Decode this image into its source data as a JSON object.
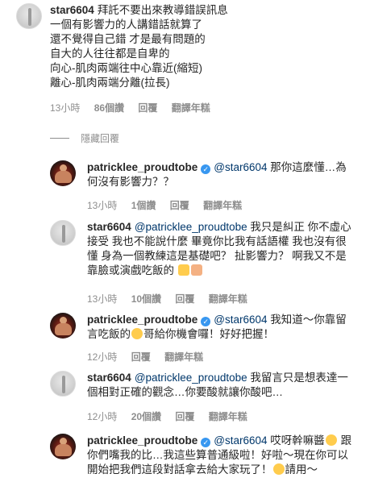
{
  "comments": [
    {
      "username": "star6604",
      "text": "拜託不要出來教導錯誤訊息\n一個有影響力的人講錯話就算了\n還不覺得自己錯 才是最有問題的\n自大的人往往都是自卑的\n向心-肌肉兩端往中心靠近(縮短)\n離心-肌肉兩端分離(拉長)",
      "time": "13小時",
      "likes": "86個讚",
      "reply": "回覆",
      "translate": "翻譯年糕"
    }
  ],
  "hide_replies_label": "隱藏回覆",
  "replies": [
    {
      "username": "patricklee_proudtobe",
      "mention": "@star6604",
      "text": "那你這麼懂…為何沒有影響力？？",
      "time": "13小時",
      "likes": "1個讚",
      "reply": "回覆",
      "translate": "翻譯年糕"
    },
    {
      "username": "star6604",
      "mention": "@patricklee_proudtobe",
      "text": "我只是糾正 你不虛心接受 我也不能說什麼 畢竟你比我有話語權 我也沒有很懂 身為一個教練這是基礎吧？ 扯影響力？ 啊我又不是靠臉或演戲吃飯的",
      "time": "13小時",
      "likes": "10個讚",
      "reply": "回覆",
      "translate": "翻譯年糕"
    },
    {
      "username": "patricklee_proudtobe",
      "mention": "@star6604",
      "text_a": "我知道～你靠留言吃飯的",
      "text_b": "哥給你機會囉！好好把握！",
      "time": "12小時",
      "likes": "",
      "reply": "回覆",
      "translate": "翻譯年糕"
    },
    {
      "username": "star6604",
      "mention": "@patricklee_proudtobe",
      "text": "我留言只是想表達一個相對正確的觀念…你要酸就讓你酸吧…",
      "time": "12小時",
      "likes": "20個讚",
      "reply": "回覆",
      "translate": "翻譯年糕"
    },
    {
      "username": "patricklee_proudtobe",
      "mention": "@star6604",
      "text_a": "哎呀幹嘛醬",
      "text_b": "跟你們嘴我的比…我這些算普通級啦！好啦～現在你可以開始把我們這段對話拿去給大家玩了！",
      "text_c": "請用～"
    }
  ]
}
